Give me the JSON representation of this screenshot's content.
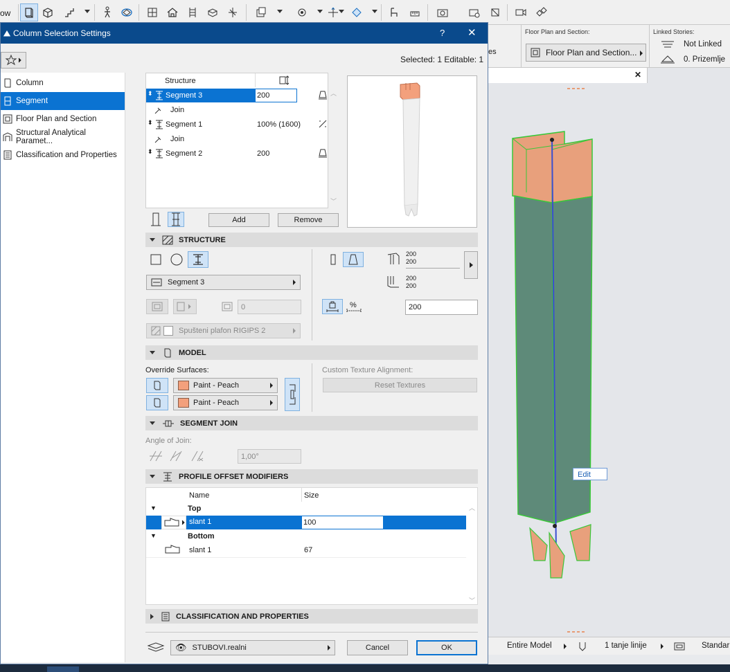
{
  "toolbar": {
    "left_cut_label": "ow",
    "icons": [
      "column-icon",
      "box-icon",
      "stair-icon",
      "walk-icon",
      "morph-icon",
      "grid-icon",
      "house-icon",
      "ladder-icon",
      "object-icon",
      "axis-icon",
      "layer-icon",
      "gear-cube-icon",
      "move-icon",
      "render-icon",
      "chair-icon",
      "measure-icon",
      "camera-icon",
      "camera-settings-icon",
      "marker-icon",
      "video-icon",
      "multi-icon"
    ]
  },
  "info_panel": {
    "view_label_partial": "es",
    "floor_plan_label": "Floor Plan and Section:",
    "floor_plan_value": "Floor Plan and Section...",
    "linked_stories_label": "Linked Stories:",
    "linked_top": "Not Linked",
    "linked_bottom": "0. Prizemlje"
  },
  "viewport": {
    "edit_tooltip": "Edit",
    "status": {
      "scope": "Entire Model",
      "pen": "1 tanje linije",
      "view": "Standar"
    }
  },
  "dialog": {
    "title": "Column Selection Settings",
    "help": "?",
    "close": "✕",
    "selected_info": "Selected: 1 Editable: 1",
    "nav": [
      {
        "label": "Column",
        "selected": false
      },
      {
        "label": "Segment",
        "selected": true
      },
      {
        "label": "Floor Plan and Section",
        "selected": false
      },
      {
        "label": "Structural Analytical Paramet...",
        "selected": false
      },
      {
        "label": "Classification and Properties",
        "selected": false
      }
    ],
    "structure_table": {
      "header": "Structure",
      "rows": [
        {
          "name": "Segment 3",
          "value": "200",
          "selected": true
        },
        {
          "name": "Join",
          "value": ""
        },
        {
          "name": "Segment 1",
          "value": "100% (1600)"
        },
        {
          "name": "Join",
          "value": ""
        },
        {
          "name": "Segment 2",
          "value": "200"
        }
      ]
    },
    "add_btn": "Add",
    "remove_btn": "Remove",
    "structure": {
      "header": "STRUCTURE",
      "segment_dropdown": "Segment 3",
      "offset_value": "0",
      "surface_dropdown": "Spušteni plafon RIGIPS 2",
      "top_dims": [
        "200",
        "200"
      ],
      "bottom_dims": [
        "200",
        "200"
      ],
      "percent_label": "%",
      "height_value": "200"
    },
    "model": {
      "header": "MODEL",
      "override_label": "Override Surfaces:",
      "surface1": "Paint - Peach",
      "surface2": "Paint - Peach",
      "custom_texture_label": "Custom Texture Alignment:",
      "reset_textures": "Reset Textures",
      "swatch_color": "#f3a07c"
    },
    "segment_join": {
      "header": "SEGMENT JOIN",
      "angle_label": "Angle of Join:",
      "angle_value": "1,00°"
    },
    "profile_offset": {
      "header": "PROFILE OFFSET MODIFIERS",
      "col_name": "Name",
      "col_size": "Size",
      "groups": [
        {
          "group": "Top",
          "items": [
            {
              "name": "slant 1",
              "size": "100",
              "selected": true
            }
          ]
        },
        {
          "group": "Bottom",
          "items": [
            {
              "name": "slant 1",
              "size": "67",
              "selected": false
            }
          ]
        }
      ]
    },
    "classification_header": "CLASSIFICATION AND PROPERTIES",
    "layer_dropdown": "STUBOVI.realni",
    "cancel": "Cancel",
    "ok": "OK"
  },
  "colors": {
    "title_bar": "#0a4a8c",
    "selection": "#0b73d2",
    "peach": "#f3a07c",
    "column_body": "#5e8a79",
    "outline_green": "#39c739"
  }
}
